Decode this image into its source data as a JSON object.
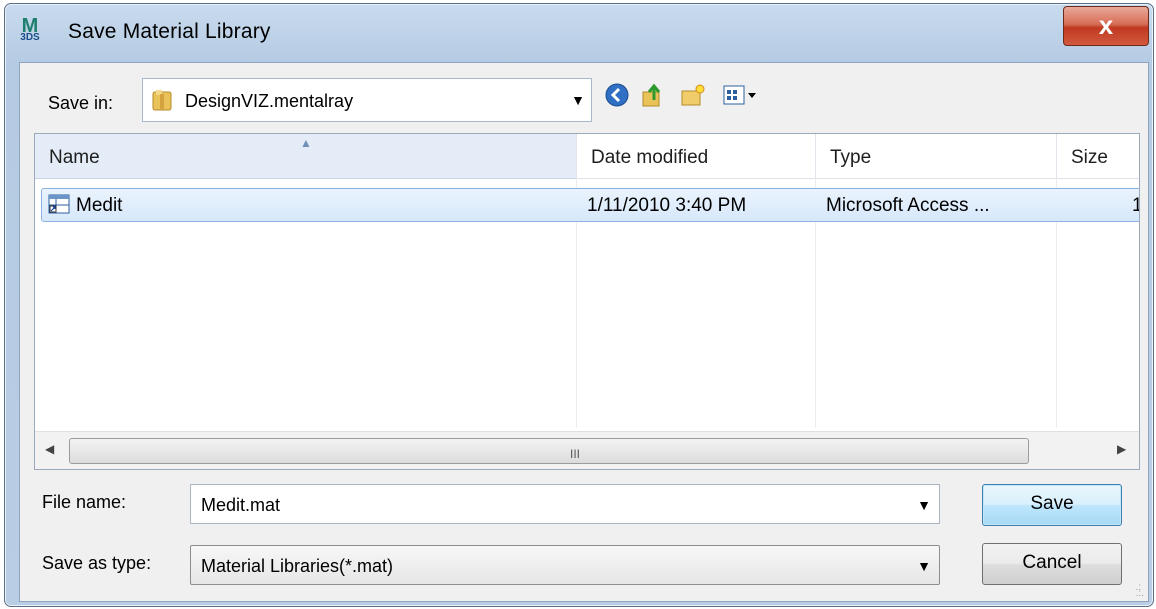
{
  "window": {
    "title": "Save Material Library",
    "app_icon_text": "M",
    "app_icon_sub": "3DS",
    "close_glyph": "x"
  },
  "toolbar": {
    "save_in_label": "Save in:",
    "save_in_value": "DesignVIZ.mentalray",
    "icons": [
      "back-icon",
      "up-folder-icon",
      "new-folder-icon",
      "view-menu-icon"
    ]
  },
  "filelist": {
    "columns": [
      {
        "label": "Name"
      },
      {
        "label": "Date modified"
      },
      {
        "label": "Type"
      },
      {
        "label": "Size"
      }
    ],
    "rows": [
      {
        "name": "Medit",
        "date": "1/11/2010 3:40 PM",
        "type": "Microsoft Access ...",
        "size": "1"
      }
    ],
    "scroll_grip": "III"
  },
  "form": {
    "file_name_label": "File name:",
    "file_name_value": "Medit.mat",
    "save_as_type_label": "Save as type:",
    "save_as_type_value": "Material Libraries(*.mat)"
  },
  "buttons": {
    "save": "Save",
    "cancel": "Cancel"
  },
  "colors": {
    "titlebar": "#b9cde4",
    "close_button": "#c0391f",
    "selection": "#d7e8fb",
    "default_button_border": "#3c7fb1"
  }
}
